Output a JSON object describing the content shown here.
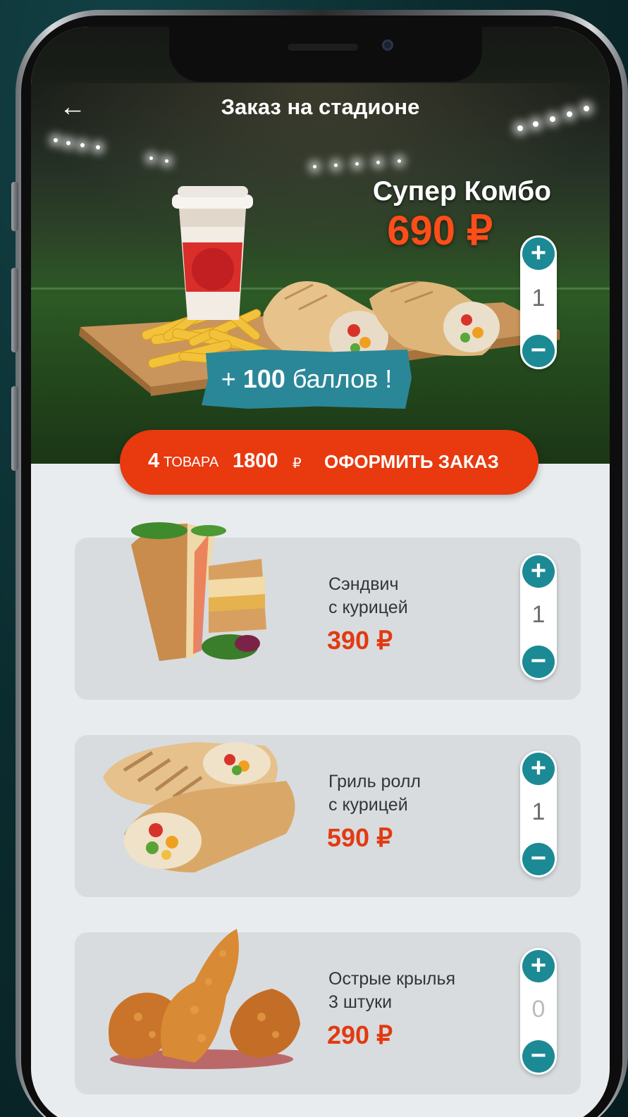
{
  "header": {
    "back_icon": "arrow-left-icon",
    "title": "Заказ на стадионе"
  },
  "hero": {
    "combo_name": "Супер Комбо",
    "combo_price": "690 ₽",
    "quantity": "1",
    "plus": "+",
    "minus": "−",
    "bonus_plus": "+ ",
    "bonus_amount": "100",
    "bonus_text": " баллов !"
  },
  "order_bar": {
    "count": "4",
    "count_label": "ТОВАРА",
    "total": "1800",
    "currency": "₽",
    "cta": "ОФОРМИТЬ ЗАКАЗ"
  },
  "items": [
    {
      "name_line1": "Сэндвич",
      "name_line2": "с курицей",
      "price": "390 ₽",
      "quantity": "1",
      "image": "chicken-sandwich"
    },
    {
      "name_line1": "Гриль ролл",
      "name_line2": "с курицей",
      "price": "590 ₽",
      "quantity": "1",
      "image": "grill-roll"
    },
    {
      "name_line1": "Острые крылья",
      "name_line2": "3 штуки",
      "price": "290 ₽",
      "quantity": "0",
      "image": "spicy-wings"
    }
  ],
  "colors": {
    "accent": "#e8390f",
    "price": "#e23a12",
    "teal": "#1b8a95",
    "bonus": "#2a8798",
    "background": "#0a2a2c"
  }
}
